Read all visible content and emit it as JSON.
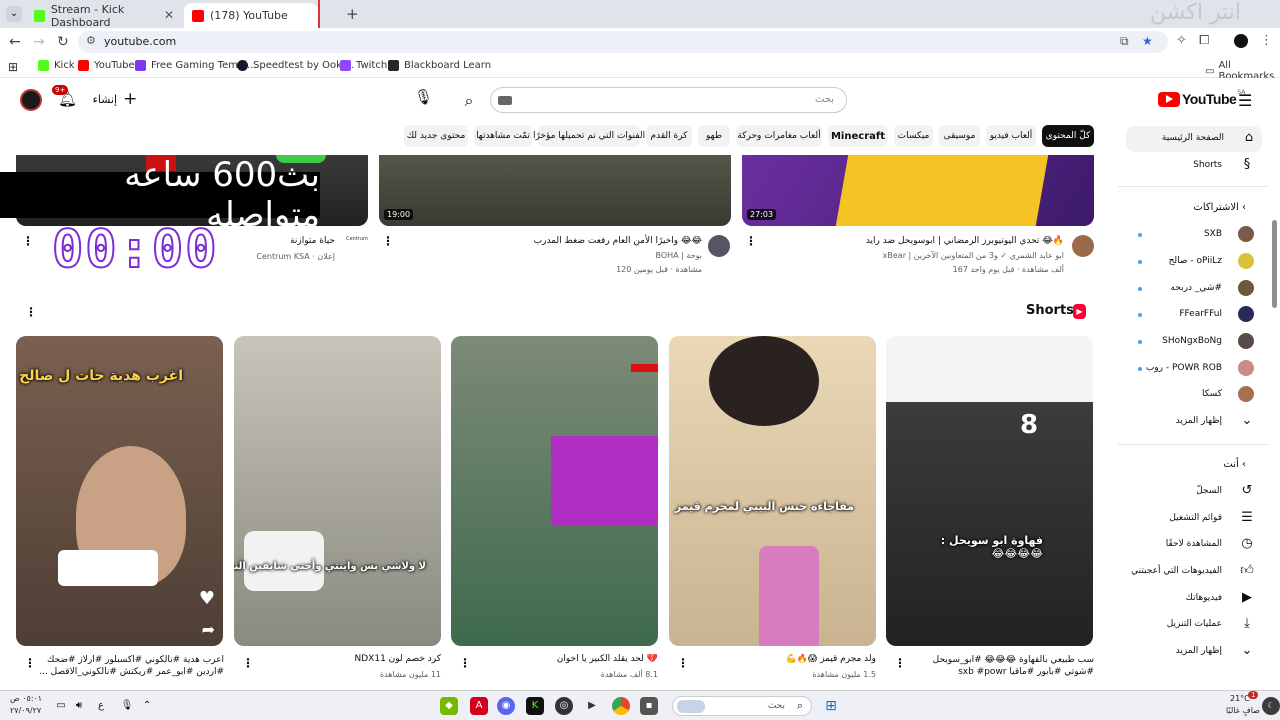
{
  "browser": {
    "tabs": [
      {
        "title": "Stream - Kick Dashboard",
        "active": false,
        "color": "#53fc18"
      },
      {
        "title": "(178) YouTube",
        "active": true,
        "color": "#ff0000"
      }
    ],
    "new_tab": "+",
    "url": "youtube.com",
    "bookmarks": [
      {
        "label": "Kick",
        "color": "#53fc18"
      },
      {
        "label": "YouTube",
        "color": "#ff0000"
      },
      {
        "label": "Free Gaming Templ...",
        "color": "#7c3aed"
      },
      {
        "label": "Speedtest by Ookl...",
        "color": "#141526"
      },
      {
        "label": "Twitch",
        "color": "#9146ff"
      },
      {
        "label": "Blackboard Learn",
        "color": "#262626"
      }
    ],
    "all_bookmarks": "All Bookmarks"
  },
  "header": {
    "logo": "YouTube",
    "country": "SA",
    "search_placeholder": "بحث",
    "create_label": "إنشاء",
    "notifications_badge": "9+"
  },
  "chips": [
    {
      "label": "كلّ المحتوى",
      "active": true,
      "bold": false
    },
    {
      "label": "ألعاب فيديو",
      "active": false,
      "bold": false
    },
    {
      "label": "موسيقى",
      "active": false,
      "bold": false
    },
    {
      "label": "ميكسات",
      "active": false,
      "bold": false
    },
    {
      "label": "Minecraft",
      "active": false,
      "bold": true
    },
    {
      "label": "ألعاب مغامرات وحركة",
      "active": false,
      "bold": false
    },
    {
      "label": "طهو",
      "active": false,
      "bold": false
    },
    {
      "label": "كرة القدم",
      "active": false,
      "bold": false
    },
    {
      "label": "الفنوات التي تم تحميلها مؤخرًا",
      "active": false,
      "bold": false
    },
    {
      "label": "تمّت مشاهدتها",
      "active": false,
      "bold": false
    },
    {
      "label": "محتوى جديد لك",
      "active": false,
      "bold": false
    }
  ],
  "sidebar": {
    "home": "الصفحة الرئيسية",
    "shorts": "Shorts",
    "subscriptions_header": "الاشتراكات",
    "subscriptions": [
      {
        "name": "SXB",
        "color": "#7a5a4a",
        "live": true
      },
      {
        "name": "صالح - oPiiLz",
        "color": "#d8c23a",
        "live": true
      },
      {
        "name": "شي_ دربحه#",
        "color": "#6b5a3a",
        "live": true
      },
      {
        "name": "FFearFFul",
        "color": "#2a2a5a",
        "live": true
      },
      {
        "name": "SHoNgxBoNg",
        "color": "#5a4a4a",
        "live": true
      },
      {
        "name": "روب - POWR ROB",
        "color": "#c88a8a",
        "live": true
      },
      {
        "name": "كسكا",
        "color": "#a87050",
        "live": false
      }
    ],
    "show_more_1": "إظهار المزيد",
    "you_header": "أنت",
    "you_items": [
      {
        "label": "السجلّ",
        "icon": "history-icon"
      },
      {
        "label": "قوائم التشغيل",
        "icon": "playlist-icon"
      },
      {
        "label": "المشاهدة لاحقًا",
        "icon": "clock-icon"
      },
      {
        "label": "الفيديوهات التي أعجبتني",
        "icon": "like-icon"
      },
      {
        "label": "فيديوهاتك",
        "icon": "video-icon"
      },
      {
        "label": "عمليات التنزيل",
        "icon": "download-icon"
      }
    ],
    "show_more_2": "إظهار المزيد"
  },
  "top_videos": [
    {
      "title": "حياة متوازنة",
      "channel": "Centrum KSA · إعلان",
      "views": "",
      "duration": "",
      "thumb_color": "#2a2a2a",
      "avatar_label": "Centrum"
    },
    {
      "title": "واخيرًا الأمن العام رفعت ضغط المدرب 😂😂",
      "channel": "BOHA | بوحة",
      "views": "120 مشاهدة · قبل يومين",
      "duration": "19:00",
      "thumb_color": "#4a4a3e"
    },
    {
      "title": "تحدي اليوتيوبرز الرمضاني | ابوسويحل ضد رايد 😂🔥",
      "channel": "xBear | ابو عابد الشمري ✓ و3 من المتعاونين الآخرين",
      "views": "167 ألف مشاهدة · قبل يوم واحد",
      "duration": "27:03",
      "thumb_color": "#5b2a8c"
    }
  ],
  "stream_overlay": {
    "text": "بث600 ساعه متواصله",
    "clock": "00:00"
  },
  "shorts": {
    "title": "Shorts",
    "items": [
      {
        "caption": "اغرب هدية جات ل صالح صدمتني معه 😂😂",
        "title": "اعرب هدية #نالكوني #اكسبلور #ارلاز #ضحك #اردين #ابو_عمر #ريكتش #نالكوني_الاقصل ...",
        "views": "",
        "bg": "#8a6a5a"
      },
      {
        "caption": "لا ولاشي بس واينتي وأحتى شايفين النتظر 😂😂",
        "title": "كرد خصم لون NDX11",
        "views": "11 مليون مشاهدة",
        "bg": "#b4b0a6"
      },
      {
        "caption": "",
        "title": "💔 لحد يقلد الكبير يا اخوان",
        "views": "8.1 ألف مشاهدة",
        "bg": "#3c7a50"
      },
      {
        "caption": "مفاجاءه جنس البيبي لمجرم قيمز",
        "title": "ولد مجرم قيمز 😱🔥💪",
        "views": "1.5 مليون مشاهدة",
        "bg": "#d9c4a0"
      },
      {
        "caption": "فهاوة ابو سويحل : 😂😂😂😂",
        "title": "سب طبيعي بالفهاوة 😂😂😂 #ابو_سويحل #شوتي #بابور #ماقيا sxb #powr",
        "views": "",
        "bg": "#2c2c2c"
      }
    ]
  },
  "taskbar": {
    "time": "٠٥:٠١ ص",
    "date": "٢٧/٠٩/٢٧",
    "weather_temp": "21°C",
    "weather_desc": "صافٍ غالبًا",
    "lang": "ع",
    "search_placeholder": "بحث",
    "notif_count": "1"
  },
  "watermark": "انتر اكشن"
}
